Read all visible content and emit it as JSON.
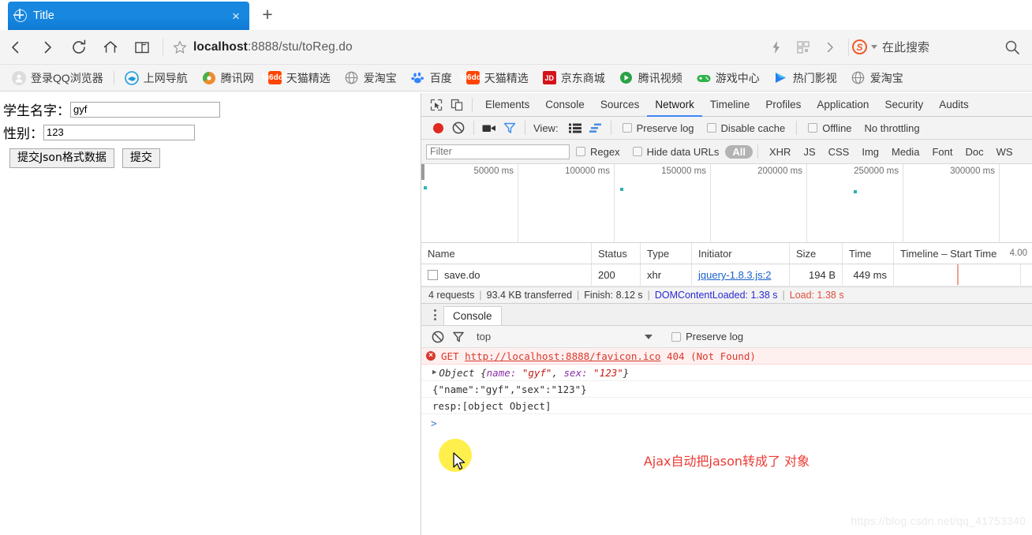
{
  "browser": {
    "tab": {
      "title": "Title",
      "favicon": "globe-icon",
      "close": "×"
    },
    "new_tab": "+",
    "url": "localhost:8888/stu/toReg.do",
    "url_host": "localhost",
    "url_path": ":8888/stu/toReg.do",
    "search_placeholder": "在此搜索",
    "search_engine_badge": "S",
    "bookmarks": [
      {
        "label": "登录QQ浏览器",
        "icon": "user-avatar-icon",
        "color": "#d9d9d9"
      },
      {
        "label": "上网导航",
        "icon": "edge-browser-icon",
        "color": "#1a9bdd"
      },
      {
        "label": "腾讯网",
        "icon": "tencent-icon",
        "color": "#f08c2e"
      },
      {
        "label": "天猫精选",
        "icon": "taobao-icon",
        "color": "#ff4400"
      },
      {
        "label": "爱淘宝",
        "icon": "globe-icon",
        "color": "#8a8a8a"
      },
      {
        "label": "百度",
        "icon": "baidu-paw-icon",
        "color": "#3385ff"
      },
      {
        "label": "天猫精选",
        "icon": "taobao-icon",
        "color": "#ff4400"
      },
      {
        "label": "京东商城",
        "icon": "jd-icon",
        "color": "#d4131a"
      },
      {
        "label": "腾讯视频",
        "icon": "tencent-video-icon",
        "color": "#2ba245"
      },
      {
        "label": "游戏中心",
        "icon": "gamepad-icon",
        "color": "#2fb34a"
      },
      {
        "label": "热门影视",
        "icon": "play-icon",
        "color": "#2a7ff0"
      },
      {
        "label": "爱淘宝",
        "icon": "globe-icon",
        "color": "#8a8a8a"
      }
    ]
  },
  "page": {
    "name_label": "学生名字：",
    "name_value": "gyf",
    "sex_label": "性别：",
    "sex_value": "123",
    "json_button": "提交Json格式数据",
    "submit_button": "提交"
  },
  "devtools": {
    "tabs": [
      {
        "label": "Elements",
        "active": false
      },
      {
        "label": "Console",
        "active": false
      },
      {
        "label": "Sources",
        "active": false
      },
      {
        "label": "Network",
        "active": true
      },
      {
        "label": "Timeline",
        "active": false
      },
      {
        "label": "Profiles",
        "active": false
      },
      {
        "label": "Application",
        "active": false
      },
      {
        "label": "Security",
        "active": false
      },
      {
        "label": "Audits",
        "active": false
      }
    ],
    "toolbar": {
      "record_icon": "record-icon",
      "clear_icon": "clear-icon",
      "camera_icon": "camera-icon",
      "filter_icon": "funnel-icon",
      "view_label": "View:",
      "view_list_icon": "list-view-icon",
      "view_waterfall_icon": "waterfall-view-icon",
      "preserve_log": "Preserve log",
      "disable_cache": "Disable cache",
      "offline": "Offline",
      "throttling": "No throttling"
    },
    "filterbar": {
      "placeholder": "Filter",
      "regex": "Regex",
      "hide_data_urls": "Hide data URLs",
      "types": [
        "All",
        "XHR",
        "JS",
        "CSS",
        "Img",
        "Media",
        "Font",
        "Doc",
        "WS"
      ],
      "selected_type": "All"
    },
    "overview_ticks": [
      "50000 ms",
      "100000 ms",
      "150000 ms",
      "200000 ms",
      "250000 ms",
      "300000 ms"
    ],
    "table": {
      "columns": [
        "Name",
        "Status",
        "Type",
        "Initiator",
        "Size",
        "Time",
        "Timeline – Start Time"
      ],
      "timeline_tick": "4.00",
      "rows": [
        {
          "name": "save.do",
          "status": "200",
          "type": "xhr",
          "initiator": "jquery-1.8.3.js:2",
          "size": "194 B",
          "time": "449 ms"
        }
      ]
    },
    "summary": {
      "requests": "4 requests",
      "transferred": "93.4 KB transferred",
      "finish": "Finish: 8.12 s",
      "dom_content_loaded": "DOMContentLoaded: 1.38 s",
      "load": "Load: 1.38 s",
      "separator": "|"
    },
    "drawer": {
      "tab": "Console",
      "context": "top",
      "preserve_log": "Preserve log",
      "lines": [
        {
          "kind": "error",
          "method": "GET",
          "url": "http://localhost:8888/favicon.ico",
          "status": "404",
          "message": "(Not Found)"
        },
        {
          "kind": "object",
          "prefix": "Object",
          "brace_open": "{",
          "key1": "name:",
          "val1": "\"gyf\"",
          "comma": ",",
          "key2": "sex:",
          "val2": "\"123\"",
          "brace_close": "}"
        },
        {
          "kind": "text",
          "text": "{\"name\":\"gyf\",\"sex\":\"123\"}"
        },
        {
          "kind": "text",
          "text": "resp:[object Object]",
          "highlight_word": "resp"
        }
      ],
      "prompt": ">"
    }
  },
  "annotation": "Ajax自动把jason转成了 对象",
  "watermark": "https://blog.csdn.net/qq_41753340",
  "colors": {
    "tab_blue": "#1787e0",
    "accent_blue": "#4285f4",
    "error_red": "#d8392b",
    "annotation_red": "#ec3a33",
    "dcl_blue": "#2a2ad6",
    "load_red": "#e0503c",
    "highlight_yellow": "#ffec2e"
  }
}
